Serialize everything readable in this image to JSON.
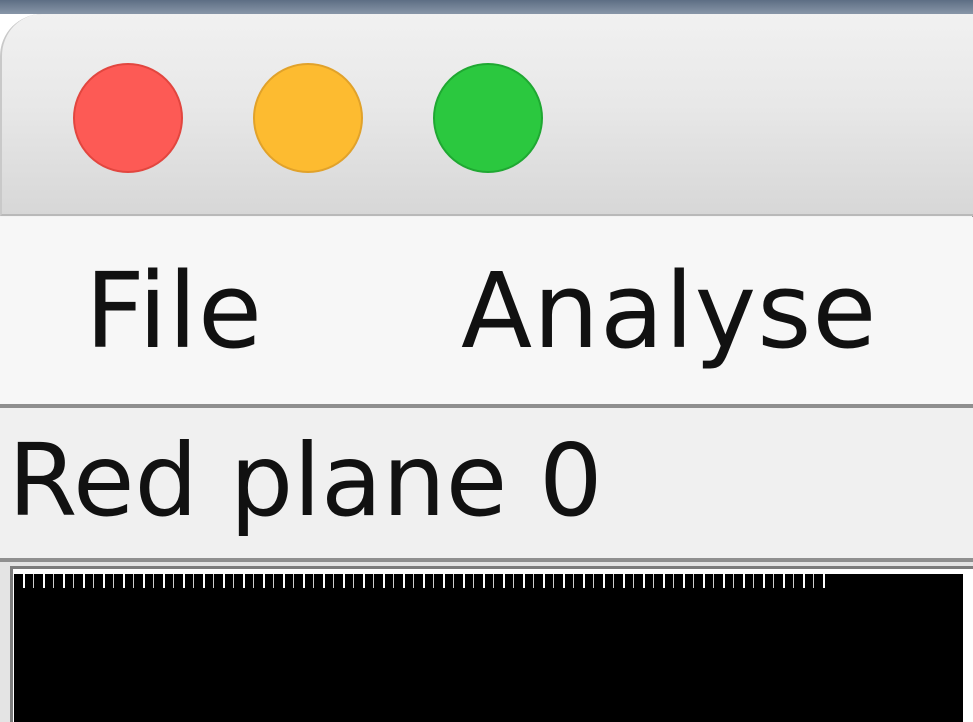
{
  "window": {
    "controls": {
      "close_color": "#fd5a55",
      "minimize_color": "#fdbb30",
      "zoom_color": "#2bc83f"
    }
  },
  "menubar": {
    "items": [
      {
        "label": "File"
      },
      {
        "label": "Analyse"
      }
    ]
  },
  "statusbar": {
    "text": "Red plane 0"
  },
  "image_view": {
    "background_color": "#000000"
  }
}
